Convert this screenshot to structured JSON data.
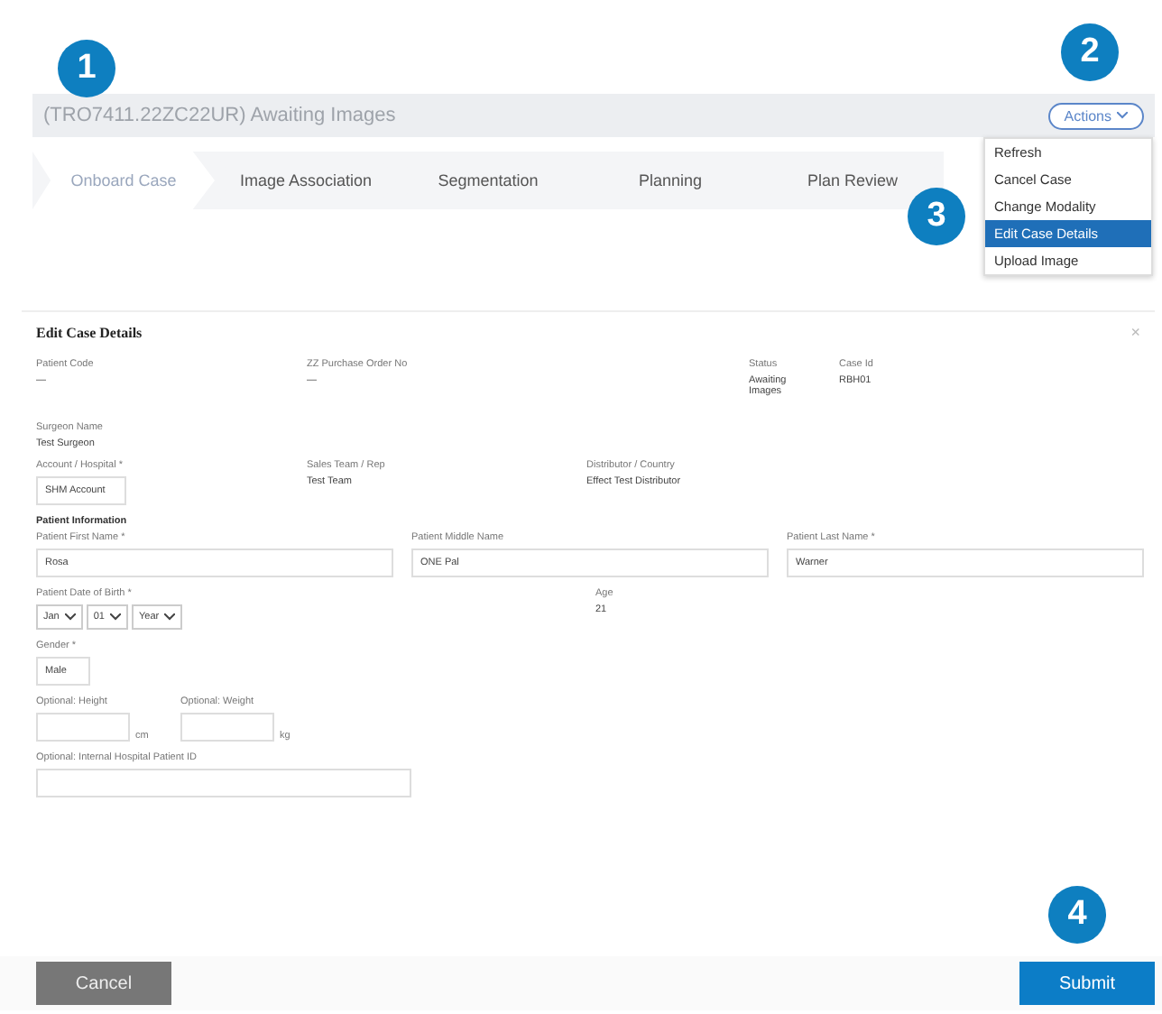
{
  "header": {
    "title": "(TRO7411.22ZC22UR) Awaiting Images",
    "actions_button": "Actions"
  },
  "actions_menu": [
    {
      "label": "Refresh",
      "selected": false
    },
    {
      "label": "Cancel Case",
      "selected": false
    },
    {
      "label": "Change Modality",
      "selected": false
    },
    {
      "label": "Edit Case Details",
      "selected": true
    },
    {
      "label": "Upload Image",
      "selected": false
    }
  ],
  "steps": [
    {
      "label": "Onboard Case",
      "selected": true
    },
    {
      "label": "Image Association",
      "selected": false
    },
    {
      "label": "Segmentation",
      "selected": false
    },
    {
      "label": "Planning",
      "selected": false
    },
    {
      "label": "Plan Review",
      "selected": false
    }
  ],
  "callouts": [
    "1",
    "2",
    "3",
    "4"
  ],
  "dialog": {
    "title": "Edit Case Details",
    "close": "×",
    "info_row": [
      {
        "label": "Patient Code",
        "value": "—"
      },
      {
        "label": "ZZ Purchase Order No",
        "value": "—"
      },
      {
        "label": "Status",
        "value": "Awaiting Images"
      },
      {
        "label": "Case Id",
        "value": "RBH01"
      }
    ],
    "surgeon": {
      "label": "Surgeon Name",
      "value": "Test Surgeon"
    },
    "account_row": [
      {
        "label": "Account / Hospital *",
        "value": "SHM Account",
        "kind": "select"
      },
      {
        "label": "Sales Team / Rep",
        "value": "Test Team",
        "kind": "text"
      },
      {
        "label": "Distributor / Country",
        "value": "Effect Test Distributor",
        "kind": "text"
      }
    ],
    "section": "Patient Information",
    "name_fields": [
      {
        "label": "Patient First Name *",
        "value": "Rosa"
      },
      {
        "label": "Patient Middle Name",
        "value": "ONE Pal"
      },
      {
        "label": "Patient Last Name *",
        "value": "Warner"
      }
    ],
    "dob": {
      "label": "Patient Date of Birth *",
      "parts": [
        "Jan",
        "01",
        "Year"
      ]
    },
    "age": {
      "label": "Age",
      "value": "21"
    },
    "gender": {
      "label": "Gender *",
      "value": "Male"
    },
    "measures": [
      {
        "label": "Optional: Height",
        "unit": "cm"
      },
      {
        "label": "Optional: Weight",
        "unit": "kg"
      }
    ],
    "hospital_id": {
      "label": "Optional: Internal Hospital Patient ID"
    }
  },
  "footer": {
    "cancel": "Cancel",
    "submit": "Submit"
  }
}
